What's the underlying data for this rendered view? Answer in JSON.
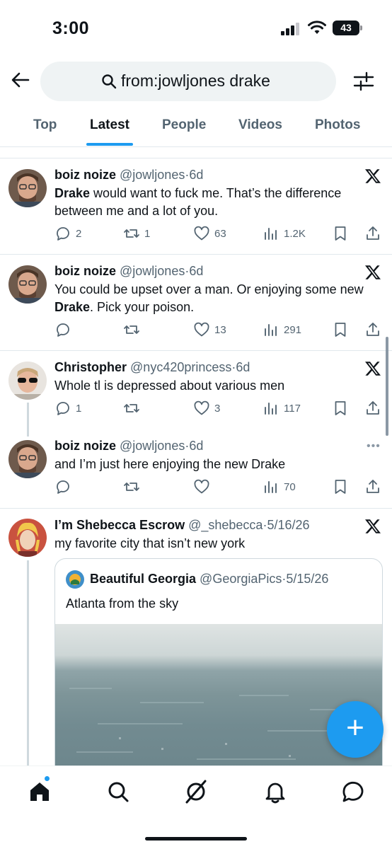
{
  "status": {
    "time": "3:00",
    "battery": "43"
  },
  "search": {
    "query": "from:jowljones drake"
  },
  "tabs": [
    {
      "label": "Top"
    },
    {
      "label": "Latest"
    },
    {
      "label": "People"
    },
    {
      "label": "Videos"
    },
    {
      "label": "Photos"
    }
  ],
  "active_tab": "Latest",
  "tweets": [
    {
      "name": "boiz noize",
      "handle": "@jowljones",
      "sep": "·",
      "time": "6d",
      "text_bold": "Drake",
      "text_rest": " would want to fuck me. That’s the difference between me and a lot of you.",
      "replies": "2",
      "retweets": "1",
      "likes": "63",
      "views": "1.2K"
    },
    {
      "name": "boiz noize",
      "handle": "@jowljones",
      "sep": "·",
      "time": "6d",
      "text_pre": "You could be upset over a man. Or enjoying some new ",
      "text_bold": "Drake",
      "text_post": ". Pick your poison.",
      "replies": "",
      "retweets": "",
      "likes": "13",
      "views": "291"
    },
    {
      "name": "Christopher",
      "handle": "@nyc420princess",
      "sep": "·",
      "time": "6d",
      "text": "Whole tl is depressed about various men",
      "replies": "1",
      "retweets": "",
      "likes": "3",
      "views": "117"
    },
    {
      "name": "boiz noize",
      "handle": "@jowljones",
      "sep": "·",
      "time": "6d",
      "text": "and I’m just here enjoying the new Drake",
      "more": "•••",
      "replies": "",
      "retweets": "",
      "likes": "",
      "views": "70"
    },
    {
      "name": "I’m Shebecca Escrow",
      "handle": "@_shebecca",
      "sep": "·",
      "time": "5/16/26",
      "text": "my favorite city that isn’t new york",
      "quote": {
        "name": "Beautiful Georgia",
        "handle": "@GeorgiaPics",
        "sep": "·",
        "time": "5/15/26",
        "text": "Atlanta from the sky"
      }
    }
  ],
  "fab": {
    "label": "+"
  },
  "colors": {
    "accent": "#1d9bf0",
    "text": "#0f1419",
    "secondary": "#536471"
  },
  "icons": [
    "back-arrow-icon",
    "search-icon",
    "filter-icon",
    "x-logo-icon",
    "reply-icon",
    "retweet-icon",
    "like-icon",
    "views-icon",
    "bookmark-icon",
    "share-icon",
    "home-icon",
    "explore-icon",
    "grok-icon",
    "notifications-icon",
    "messages-icon"
  ]
}
